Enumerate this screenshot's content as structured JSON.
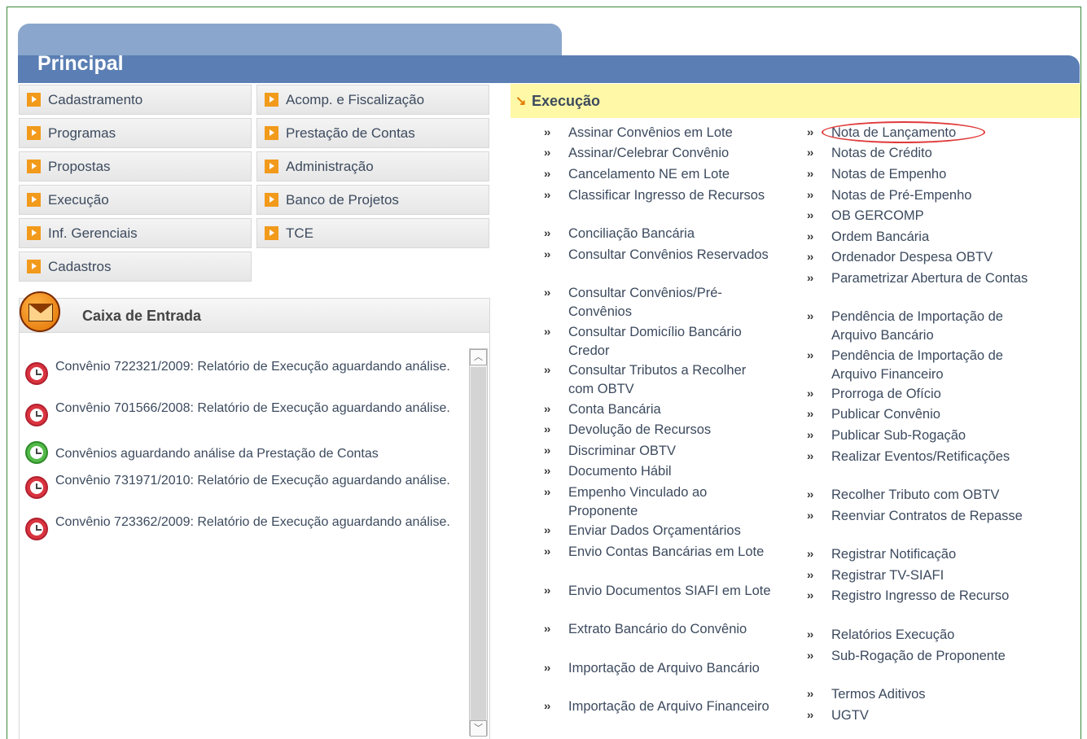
{
  "header": {
    "title": "Principal"
  },
  "menu": {
    "left": [
      "Cadastramento",
      "Programas",
      "Propostas",
      "Execução",
      "Inf. Gerenciais",
      "Cadastros"
    ],
    "right": [
      "Acomp. e Fiscalização",
      "Prestação de Contas",
      "Administração",
      "Banco de Projetos",
      "TCE"
    ]
  },
  "inbox": {
    "title": "Caixa de Entrada",
    "messages": [
      {
        "text": "Convênio 722321/2009: Relatório de Execução aguardando análise.",
        "status": "red"
      },
      {
        "text": "Convênio 701566/2008: Relatório de Execução aguardando análise.",
        "status": "red"
      },
      {
        "text": "Convênios aguardando análise da Prestação de Contas",
        "status": "green"
      },
      {
        "text": "Convênio 731971/2010: Relatório de Execução aguardando análise.",
        "status": "red"
      },
      {
        "text": "Convênio 723362/2009: Relatório de Execução aguardando análise.",
        "status": "red"
      }
    ]
  },
  "execucao": {
    "arrow": "↘",
    "title": "Execução",
    "bullet": "››",
    "col1": [
      "Assinar Convênios em Lote",
      "Assinar/Celebrar Convênio",
      "Cancelamento NE em Lote",
      "Classificar Ingresso de Recursos",
      "Conciliação Bancária",
      "Consultar Convênios Reservados",
      "Consultar Convênios/Pré-Convênios",
      "Consultar Domicílio Bancário Credor",
      "Consultar Tributos a Recolher com OBTV",
      "Conta Bancária",
      "Devolução de Recursos",
      "Discriminar OBTV",
      "Documento Hábil",
      "Empenho Vinculado ao Proponente",
      "Enviar Dados Orçamentários",
      "Envio Contas Bancárias em Lote",
      "Envio Documentos SIAFI em Lote",
      "Extrato Bancário do Convênio",
      "Importação de Arquivo Bancário",
      "Importação de Arquivo Financeiro"
    ],
    "col2": [
      "Nota de Lançamento",
      "Notas de Crédito",
      "Notas de Empenho",
      "Notas de Pré-Empenho",
      "OB GERCOMP",
      "Ordem Bancária",
      "Ordenador Despesa OBTV",
      "Parametrizar Abertura de Contas",
      "Pendência de Importação de Arquivo Bancário",
      "Pendência de Importação de Arquivo Financeiro",
      "Prorroga de Ofício",
      "Publicar Convênio",
      "Publicar Sub-Rogação",
      "Realizar Eventos/Retificações",
      "Recolher Tributo com OBTV",
      "Reenviar Contratos de Repasse",
      "Registrar Notificação",
      "Registrar TV-SIAFI",
      "Registro Ingresso de Recurso",
      "Relatórios Execução",
      "Sub-Rogação de Proponente",
      "Termos Aditivos",
      "UGTV"
    ]
  }
}
